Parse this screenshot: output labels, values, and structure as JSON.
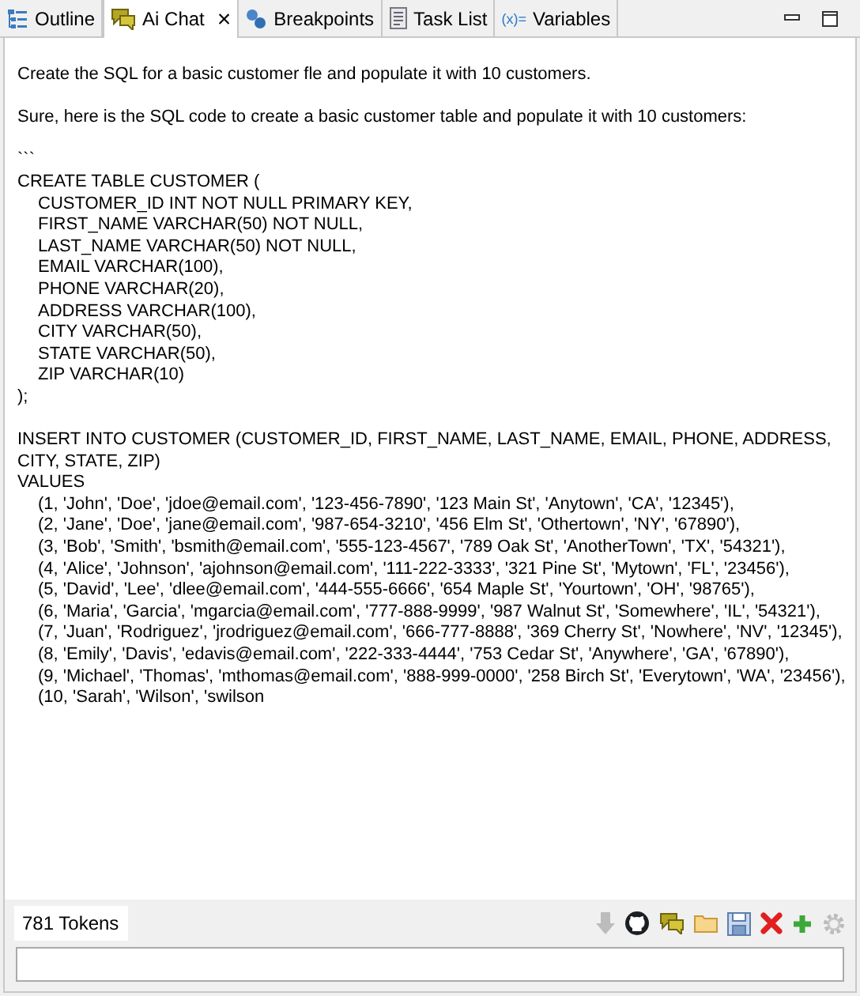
{
  "tabs": [
    {
      "label": "Outline",
      "kind": "outline",
      "selected": false
    },
    {
      "label": "Ai Chat",
      "kind": "chat",
      "selected": true,
      "close": "×"
    },
    {
      "label": "Breakpoints",
      "kind": "breakpoints",
      "selected": false
    },
    {
      "label": "Task List",
      "kind": "tasks",
      "selected": false
    },
    {
      "label": "Variables",
      "kind": "variables",
      "selected": false,
      "prefix": "(x)="
    }
  ],
  "chat": {
    "blocks": [
      [
        {
          "text": "Create the SQL for a basic customer fle and populate it with 10 customers.",
          "indent": false
        }
      ],
      [
        {
          "text": "Sure, here is the SQL code to create a basic customer table and populate it with 10 customers:",
          "indent": false
        }
      ],
      [
        {
          "text": "```",
          "indent": false
        },
        {
          "text": "CREATE TABLE CUSTOMER (",
          "indent": false
        },
        {
          "text": "CUSTOMER_ID INT NOT NULL PRIMARY KEY,",
          "indent": true
        },
        {
          "text": "FIRST_NAME VARCHAR(50) NOT NULL,",
          "indent": true
        },
        {
          "text": "LAST_NAME VARCHAR(50) NOT NULL,",
          "indent": true
        },
        {
          "text": "EMAIL VARCHAR(100),",
          "indent": true
        },
        {
          "text": "PHONE VARCHAR(20),",
          "indent": true
        },
        {
          "text": "ADDRESS VARCHAR(100),",
          "indent": true
        },
        {
          "text": "CITY VARCHAR(50),",
          "indent": true
        },
        {
          "text": "STATE VARCHAR(50),",
          "indent": true
        },
        {
          "text": "ZIP VARCHAR(10)",
          "indent": true
        },
        {
          "text": ");",
          "indent": false
        }
      ],
      [
        {
          "text": "INSERT INTO CUSTOMER (CUSTOMER_ID, FIRST_NAME, LAST_NAME, EMAIL, PHONE, ADDRESS, CITY, STATE, ZIP)",
          "indent": false
        },
        {
          "text": "VALUES",
          "indent": false
        },
        {
          "text": "(1, 'John', 'Doe', 'jdoe@email.com', '123-456-7890', '123 Main St', 'Anytown', 'CA', '12345'),",
          "indent": true
        },
        {
          "text": "(2, 'Jane', 'Doe', 'jane@email.com', '987-654-3210', '456 Elm St', 'Othertown', 'NY', '67890'),",
          "indent": true
        },
        {
          "text": "(3, 'Bob', 'Smith', 'bsmith@email.com', '555-123-4567', '789 Oak St', 'AnotherTown', 'TX', '54321'),",
          "indent": true
        },
        {
          "text": "(4, 'Alice', 'Johnson', 'ajohnson@email.com', '111-222-3333', '321 Pine St', 'Mytown', 'FL', '23456'),",
          "indent": true
        },
        {
          "text": "(5, 'David', 'Lee', 'dlee@email.com', '444-555-6666', '654 Maple St', 'Yourtown', 'OH', '98765'),",
          "indent": true
        },
        {
          "text": "(6, 'Maria', 'Garcia', 'mgarcia@email.com', '777-888-9999', '987 Walnut St', 'Somewhere', 'IL', '54321'),",
          "indent": true
        },
        {
          "text": "(7, 'Juan', 'Rodriguez', 'jrodriguez@email.com', '666-777-8888', '369 Cherry St', 'Nowhere', 'NV', '12345'),",
          "indent": true
        },
        {
          "text": "(8, 'Emily', 'Davis', 'edavis@email.com', '222-333-4444', '753 Cedar St', 'Anywhere', 'GA', '67890'),",
          "indent": true
        },
        {
          "text": "(9, 'Michael', 'Thomas', 'mthomas@email.com', '888-999-0000', '258 Birch St', 'Everytown', 'WA', '23456'),",
          "indent": true
        },
        {
          "text": "(10, 'Sarah', 'Wilson', 'swilson",
          "indent": true
        }
      ]
    ]
  },
  "footer": {
    "tokens": "781 Tokens",
    "tools": [
      {
        "kind": "download",
        "disabled": true
      },
      {
        "kind": "github",
        "disabled": false
      },
      {
        "kind": "chat",
        "disabled": false
      },
      {
        "kind": "folder",
        "disabled": false
      },
      {
        "kind": "save",
        "disabled": false
      },
      {
        "kind": "delete",
        "disabled": false
      },
      {
        "kind": "add",
        "disabled": false
      },
      {
        "kind": "settings",
        "disabled": true
      }
    ]
  }
}
